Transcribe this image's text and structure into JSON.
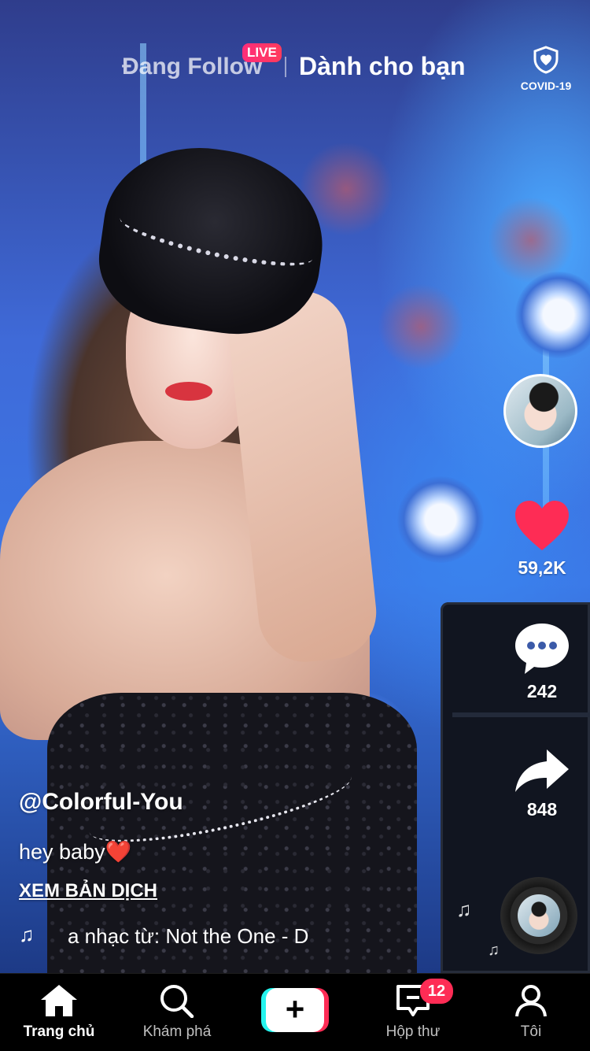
{
  "top_bar": {
    "following_tab": "Đang Follow",
    "live_badge": "LIVE",
    "for_you_tab": "Dành cho bạn",
    "covid_label": "COVID-19"
  },
  "actions": {
    "likes": "59,2K",
    "comments": "242",
    "shares": "848"
  },
  "video": {
    "username": "@Colorful-You",
    "caption": "hey baby",
    "caption_emoji": "❤️",
    "translate_label": "XEM BẢN DỊCH",
    "sound": "a nhạc từ: Not the One - D"
  },
  "bottom_nav": {
    "home": "Trang chủ",
    "discover": "Khám phá",
    "create": "+",
    "inbox": "Hộp thư",
    "inbox_badge": "12",
    "profile": "Tôi"
  },
  "colors": {
    "like": "#fe2c55",
    "accent_cyan": "#25f4ee",
    "badge": "#fe2c55"
  },
  "icons": [
    "home-icon",
    "search-icon",
    "plus-icon",
    "inbox-icon",
    "profile-icon",
    "heart-icon",
    "comment-icon",
    "share-icon",
    "shield-heart-icon",
    "music-note-icon"
  ]
}
